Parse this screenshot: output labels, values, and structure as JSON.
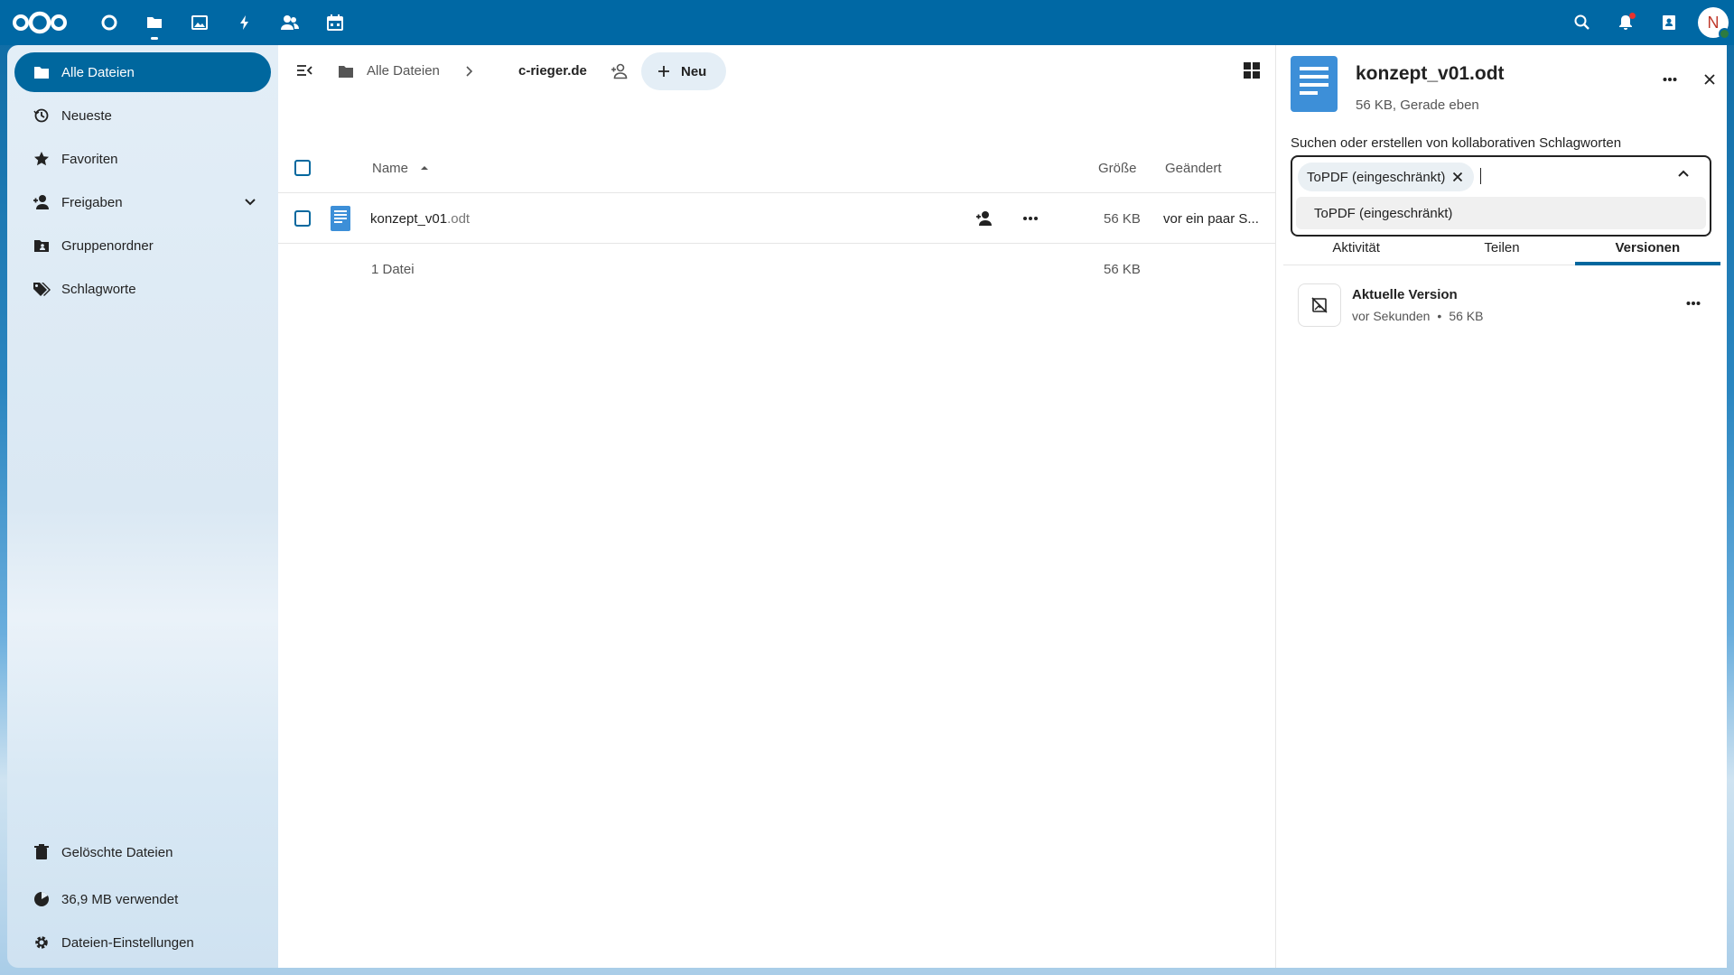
{
  "colors": {
    "topbar": "#0068a4",
    "primary": "#00679e",
    "file_icon": "#3d8fd8"
  },
  "topbar": {
    "apps": [
      {
        "name": "dashboard",
        "icon": "circle-icon"
      },
      {
        "name": "files",
        "icon": "folder-icon",
        "active": true
      },
      {
        "name": "photos",
        "icon": "image-icon"
      },
      {
        "name": "activity",
        "icon": "lightning-icon"
      },
      {
        "name": "contacts",
        "icon": "people-icon"
      },
      {
        "name": "calendar",
        "icon": "calendar-icon"
      }
    ],
    "avatar_initial": "N"
  },
  "sidebar": {
    "items": [
      {
        "label": "Alle Dateien",
        "icon": "folder-icon",
        "active": true
      },
      {
        "label": "Neueste",
        "icon": "history-icon"
      },
      {
        "label": "Favoriten",
        "icon": "star-icon"
      },
      {
        "label": "Freigaben",
        "icon": "share-icon",
        "expandable": true
      },
      {
        "label": "Gruppenordner",
        "icon": "group-folder-icon"
      },
      {
        "label": "Schlagworte",
        "icon": "tag-icon"
      }
    ],
    "footer": {
      "trash": "Gelöschte Dateien",
      "quota": "36,9 MB verwendet",
      "settings": "Dateien-Einstellungen"
    }
  },
  "toolbar": {
    "breadcrumb_root": "Alle Dateien",
    "breadcrumb_current": "c-rieger.de",
    "new_label": "Neu"
  },
  "table": {
    "columns": {
      "name": "Name",
      "size": "Größe",
      "modified": "Geändert"
    },
    "rows": [
      {
        "basename": "konzept_v01",
        "extension": ".odt",
        "size": "56 KB",
        "modified": "vor ein paar S..."
      }
    ],
    "summary": {
      "count": "1 Datei",
      "size": "56 KB"
    }
  },
  "details": {
    "filename": "konzept_v01.odt",
    "subtitle": "56 KB, Gerade eben",
    "tags": {
      "label": "Suchen oder erstellen von kollaborativen Schlagworten",
      "selected": "ToPDF (eingeschränkt)",
      "option": "ToPDF (eingeschränkt)"
    },
    "tabs": [
      "Aktivität",
      "Teilen",
      "Versionen"
    ],
    "active_tab": "Versionen",
    "version": {
      "title": "Aktuelle Version",
      "time": "vor Sekunden",
      "size": "56 KB"
    }
  }
}
